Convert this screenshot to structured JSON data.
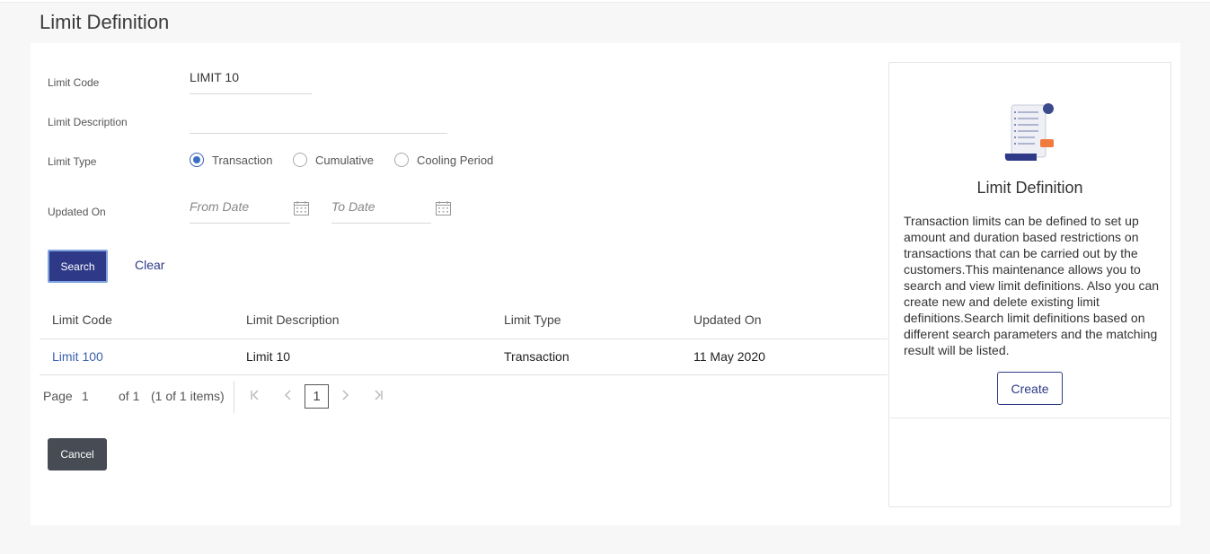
{
  "page": {
    "title": "Limit Definition"
  },
  "form": {
    "limit_code_label": "Limit Code",
    "limit_code_value": "LIMIT 10",
    "limit_description_label": "Limit Description",
    "limit_description_value": "",
    "limit_type_label": "Limit Type",
    "limit_type_options": [
      "Transaction",
      "Cumulative",
      "Cooling Period"
    ],
    "limit_type_selected": "Transaction",
    "updated_on_label": "Updated On",
    "from_date_placeholder": "From Date",
    "to_date_placeholder": "To Date",
    "search_label": "Search",
    "clear_label": "Clear"
  },
  "table": {
    "headers": [
      "Limit Code",
      "Limit Description",
      "Limit Type",
      "Updated On"
    ],
    "rows": [
      {
        "code": "Limit 100",
        "description": "Limit 10",
        "type": "Transaction",
        "updated": "11 May 2020"
      }
    ]
  },
  "pagination": {
    "page_label": "Page",
    "page": "1",
    "of_label": "of 1",
    "items_label": "(1 of 1 items)",
    "current": "1",
    "first_icon": "K",
    "prev_icon": "‹",
    "next_icon": "›",
    "last_icon": "K"
  },
  "actions": {
    "cancel_label": "Cancel"
  },
  "side_panel": {
    "title": "Limit Definition",
    "description": "Transaction limits can be defined to set up amount and duration based restrictions on transactions that can be carried out by the customers.This maintenance allows you to search and view limit definitions. Also you can create new and delete existing limit definitions.Search limit definitions based on different search parameters and the matching result will be listed.",
    "create_label": "Create"
  },
  "colors": {
    "primary": "#2e3a87",
    "link": "#3d62b0",
    "cancel": "#474b54"
  }
}
